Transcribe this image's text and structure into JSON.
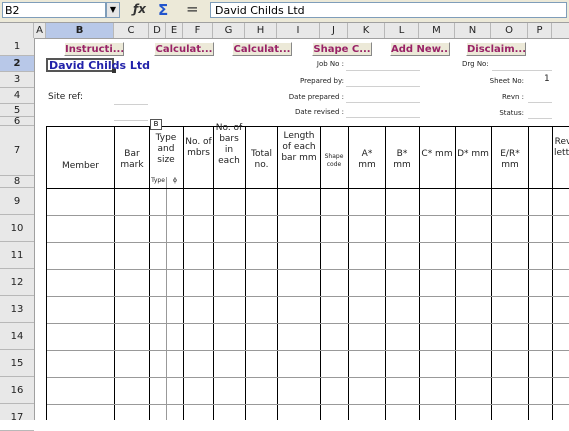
{
  "formula_bar": {
    "name_box": "B2",
    "formula": "David Childs Ltd"
  },
  "columns": [
    "A",
    "B",
    "C",
    "D",
    "E",
    "F",
    "G",
    "H",
    "I",
    "J",
    "K",
    "L",
    "M",
    "N",
    "O",
    "P"
  ],
  "rows": [
    "1",
    "2",
    "3",
    "4",
    "5",
    "6",
    "7",
    "8",
    "9",
    "10",
    "11",
    "12",
    "13",
    "14",
    "15",
    "16",
    "17"
  ],
  "buttons": {
    "instructions": "Instructi...",
    "calculate1": "Calculat...",
    "calculate2": "Calculat...",
    "shape_codes": "Shape C...",
    "add_new": "Add New...",
    "disclaimer": "Disclaim..."
  },
  "company": "David Childs Ltd",
  "labels": {
    "site_ref": "Site ref:",
    "job_no": "Job No :",
    "prepared_by": "Prepared by:",
    "date_prepared": "Date prepared :",
    "date_revised": "Date revised :",
    "drg_no": "Drg No:",
    "sheet_no": "Sheet No:",
    "revn": "Revn :",
    "status": "Status:",
    "sheet_no_value": "1"
  },
  "table": {
    "marker": "B",
    "headers": {
      "member": "Member",
      "bar_mark": "Bar mark",
      "type_size": "Type and size",
      "type_sub": "Type",
      "phi_sub": "ϕ",
      "no_mbrs": "No. of mbrs",
      "bars_each": "No. of bars in each",
      "total": "Total no.",
      "length": "Length of each bar mm",
      "shape_code": "Shape code",
      "a": "A* mm",
      "b": "B* mm",
      "c": "C* mm",
      "d": "D* mm",
      "er": "E/R* mm",
      "rev": "Rev letter"
    }
  },
  "colors": {
    "button_text": "#992266",
    "company_text": "#2222aa",
    "header_bg": "#e8e8e8",
    "selected_header": "#b8c8e8"
  }
}
